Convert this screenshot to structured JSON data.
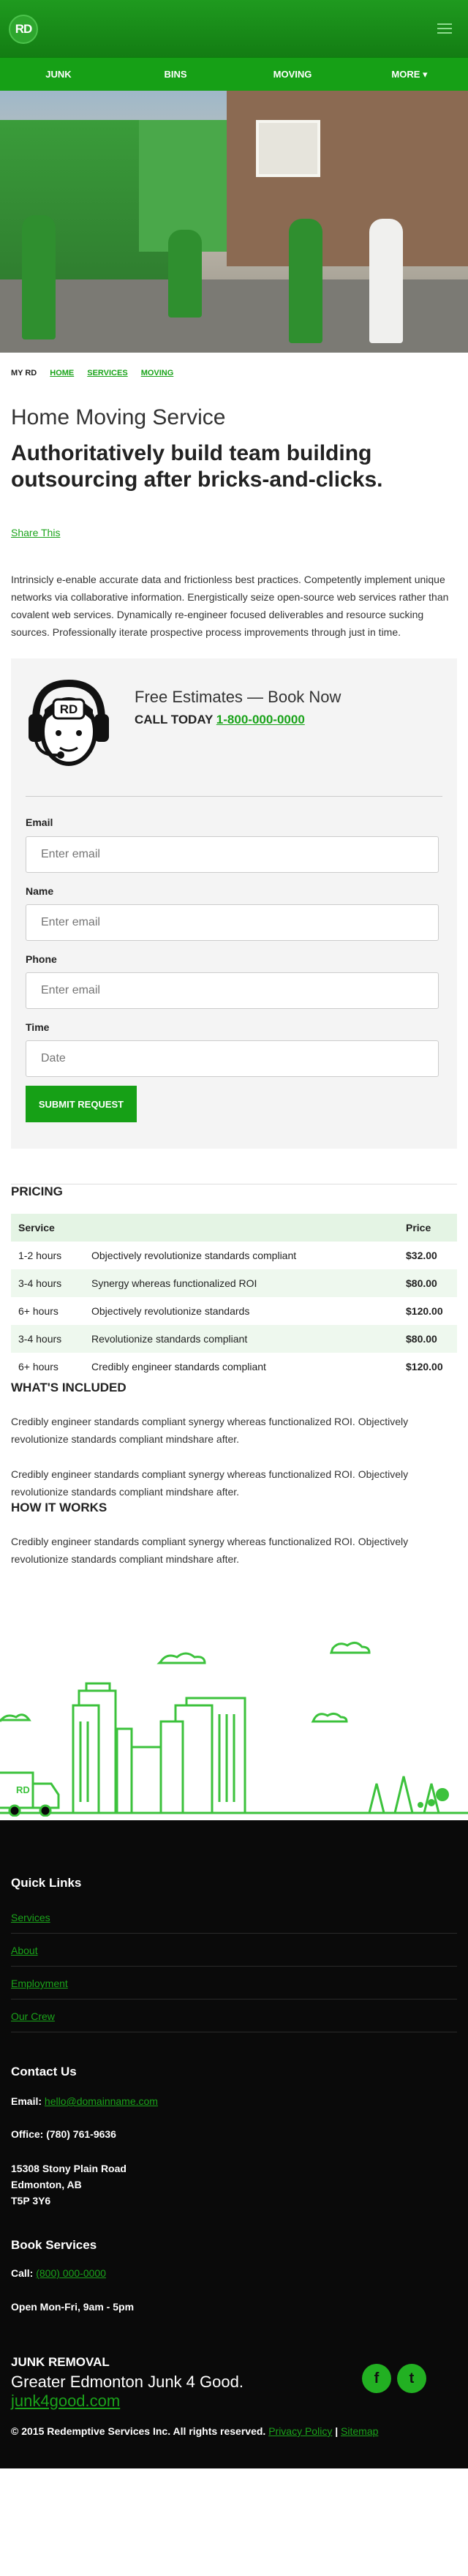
{
  "header": {
    "logo_text": "RD",
    "menu_icon": "hamburger-icon",
    "brand_color": "#16a016"
  },
  "nav": [
    {
      "label": "JUNK"
    },
    {
      "label": "BINS"
    },
    {
      "label": "MOVING"
    },
    {
      "label": "MORE ▾"
    }
  ],
  "breadcrumb": {
    "root": "MY RD",
    "items": [
      "HOME",
      "SERVICES",
      "MOVING"
    ]
  },
  "page": {
    "title": "Home Moving Service",
    "subtitle": "Authoritatively build team building outsourcing after bricks-and-clicks.",
    "share": "Share This",
    "intro": "Intrinsicly e-enable accurate data and frictionless best practices. Competently implement unique networks via collaborative information. Energistically seize open-source web services rather than covalent web services. Dynamically re-engineer focused deliverables and resource sucking sources. Professionally iterate prospective process improvements through just in time."
  },
  "estimate": {
    "title": "Free Estimates — Book Now",
    "call_prefix": "CALL TODAY ",
    "phone": "1-800-000-0000",
    "fields": [
      {
        "label": "Email",
        "placeholder": "Enter email"
      },
      {
        "label": "Name",
        "placeholder": "Enter email"
      },
      {
        "label": "Phone",
        "placeholder": "Enter email"
      },
      {
        "label": "Time",
        "placeholder": "Date"
      }
    ],
    "submit": "SUBMIT REQUEST"
  },
  "pricing": {
    "heading": "PRICING",
    "columns": [
      "Service",
      "",
      "Price"
    ],
    "rows": [
      {
        "service": "1-2 hours",
        "desc": "Objectively revolutionize standards compliant",
        "price": "$32.00"
      },
      {
        "service": "3-4 hours",
        "desc": "Synergy whereas functionalized ROI",
        "price": "$80.00"
      },
      {
        "service": "6+ hours",
        "desc": "Objectively revolutionize standards",
        "price": "$120.00"
      },
      {
        "service": "3-4 hours",
        "desc": "Revolutionize standards compliant",
        "price": "$80.00"
      },
      {
        "service": "6+ hours",
        "desc": "Credibly engineer standards compliant",
        "price": "$120.00"
      }
    ]
  },
  "included": {
    "heading": "WHAT'S INCLUDED",
    "p1": "Credibly engineer standards compliant synergy whereas functionalized ROI. Objectively revolutionize standards compliant mindshare after.",
    "p2": "Credibly engineer standards compliant synergy whereas functionalized ROI. Objectively revolutionize standards compliant mindshare after."
  },
  "how": {
    "heading": "HOW IT WORKS",
    "p1": "Credibly engineer standards compliant synergy whereas functionalized ROI. Objectively revolutionize standards compliant mindshare after."
  },
  "footer": {
    "quick_links_heading": "Quick Links",
    "quick_links": [
      "Services",
      "About",
      "Employment",
      "Our Crew"
    ],
    "contact_heading": "Contact Us",
    "email_label": "Email: ",
    "email": "hello@domainname.com",
    "office": "Office: (780) 761-9636",
    "address1": "15308 Stony Plain Road",
    "address2": "Edmonton, AB",
    "address3": "T5P 3Y6",
    "book_heading": "Book Services",
    "call_label": "Call: ",
    "call_phone": "(800) 000-0000",
    "hours": "Open Mon-Fri, 9am - 5pm",
    "brand_line1": "JUNK REMOVAL",
    "brand_line2": "Greater Edmonton Junk 4 Good.",
    "brand_line3": "junk4good.com",
    "social": [
      {
        "icon": "facebook-icon",
        "glyph": "f"
      },
      {
        "icon": "twitter-icon",
        "glyph": "t"
      }
    ],
    "copyright": "© 2015 Redemptive Services Inc. All rights reserved. ",
    "privacy": "Privacy Policy",
    "sitemap": "Sitemap"
  }
}
